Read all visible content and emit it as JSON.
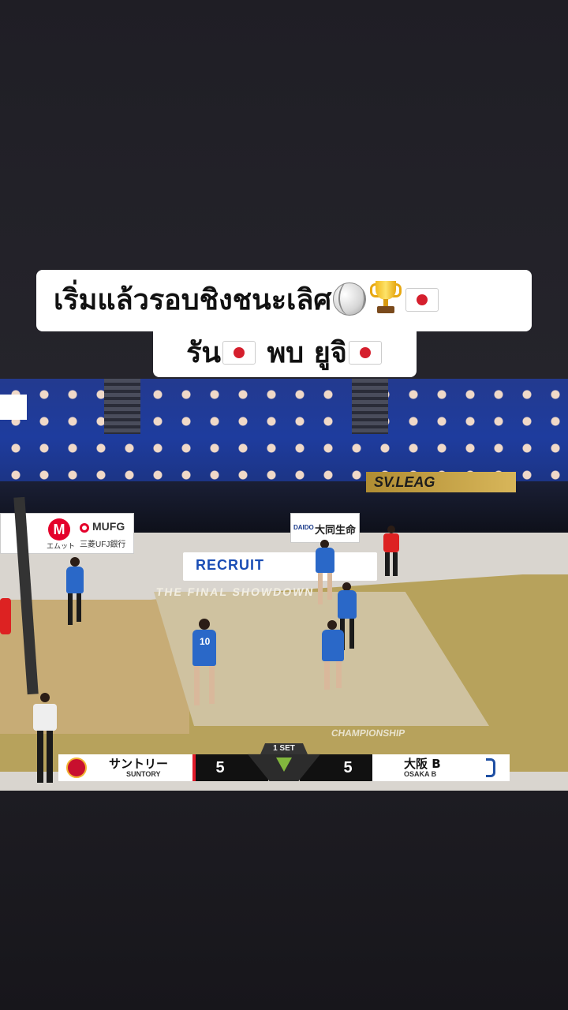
{
  "caption": {
    "line1_text": "เริ่มแล้วรอบชิงชนะเลิศ",
    "line2_a": "รัน",
    "line2_b": " พบ ยูจิ"
  },
  "icons": [
    "volleyball-icon",
    "trophy-icon",
    "japan-flag-icon"
  ],
  "video": {
    "banners": {
      "sv_league": "SV.LEAG",
      "mufg_m": "M",
      "mufg_m_sub": "エムット",
      "mufg": "MUFG",
      "mufg_bank": "三菱UFJ銀行",
      "daido_en": "DAIDO",
      "daido": "大同生命",
      "recruit": "RECRUIT",
      "showdown": "THE FINAL SHOWDOWN",
      "championship": "CHAMPIONSHIP"
    },
    "player_numbers": [
      "10"
    ],
    "scoreboard": {
      "set_label": "1 SET",
      "home_team_jp": "サントリー",
      "home_team_en": "SUNTORY",
      "home_score": "5",
      "away_team_jp": "大阪 B",
      "away_team_en": "OSAKA B",
      "away_score": "5"
    }
  },
  "colors": {
    "background": "#222129",
    "caption_bg": "#ffffff",
    "team_blue": "#2a68c8",
    "suntory_red": "#c8102e"
  }
}
